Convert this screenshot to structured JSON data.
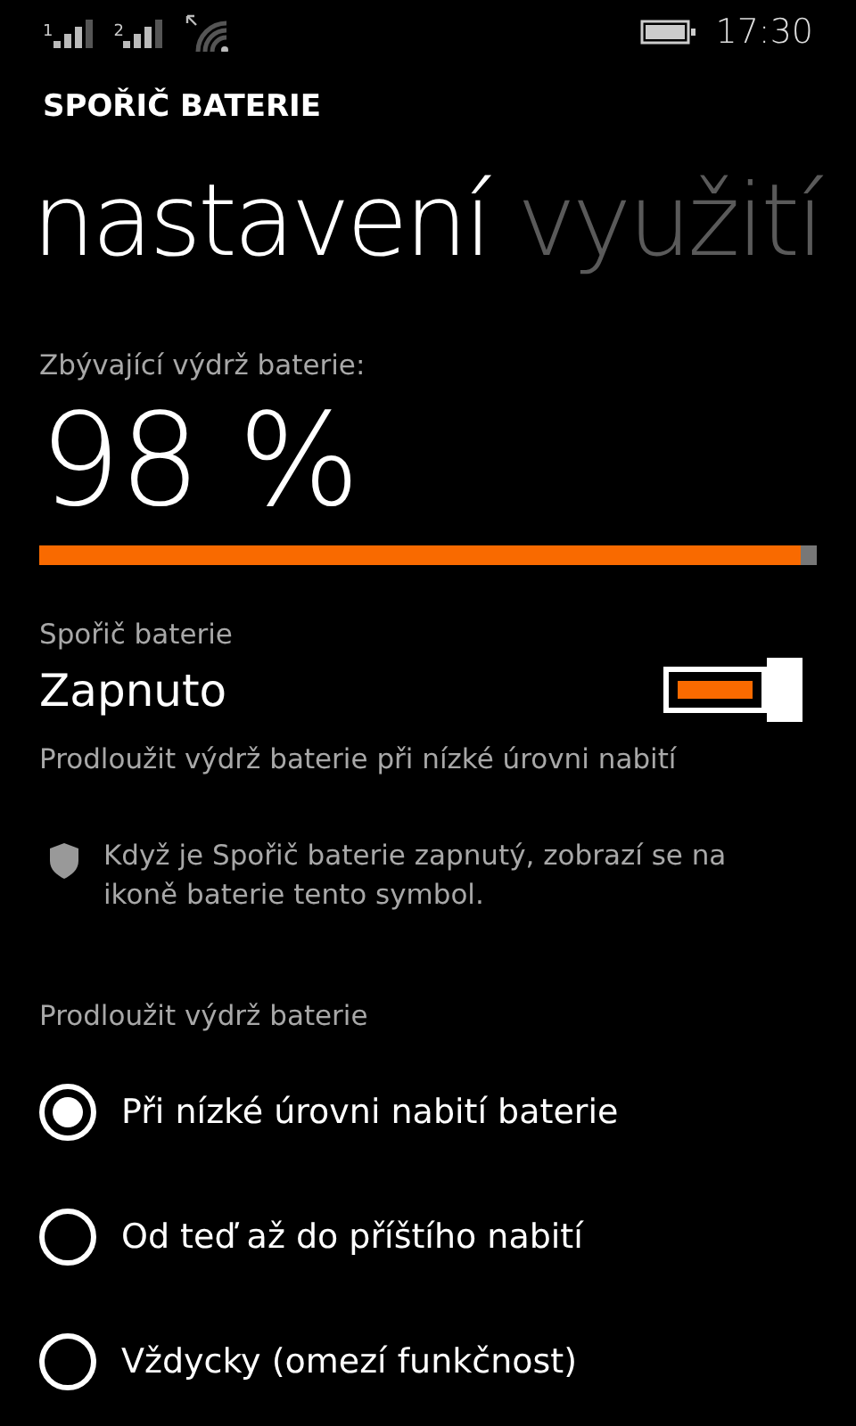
{
  "status_bar": {
    "sim_slots": [
      "1",
      "2"
    ],
    "time": "17:30"
  },
  "app_title": "SPOŘIČ BATERIE",
  "pivot": [
    {
      "label": "nastavení",
      "selected": true
    },
    {
      "label": "využití",
      "selected": false
    }
  ],
  "remaining": {
    "label": "Zbývající výdrž baterie:",
    "value": "98 %",
    "level": 0.98
  },
  "saver": {
    "label": "Spořič baterie",
    "state": "Zapnuto",
    "on": true,
    "description": "Prodloužit výdrž baterie při nízké úrovni nabití"
  },
  "info": "Když je Spořič baterie zapnutý, zobrazí se na ikoně baterie tento symbol.",
  "extend": {
    "label": "Prodloužit výdrž baterie",
    "options": [
      {
        "label": "Při nízké úrovni nabití baterie",
        "selected": true
      },
      {
        "label": "Od teď až do příštího nabití",
        "selected": false
      },
      {
        "label": "Vždycky (omezí funkčnost)",
        "selected": false
      }
    ]
  }
}
